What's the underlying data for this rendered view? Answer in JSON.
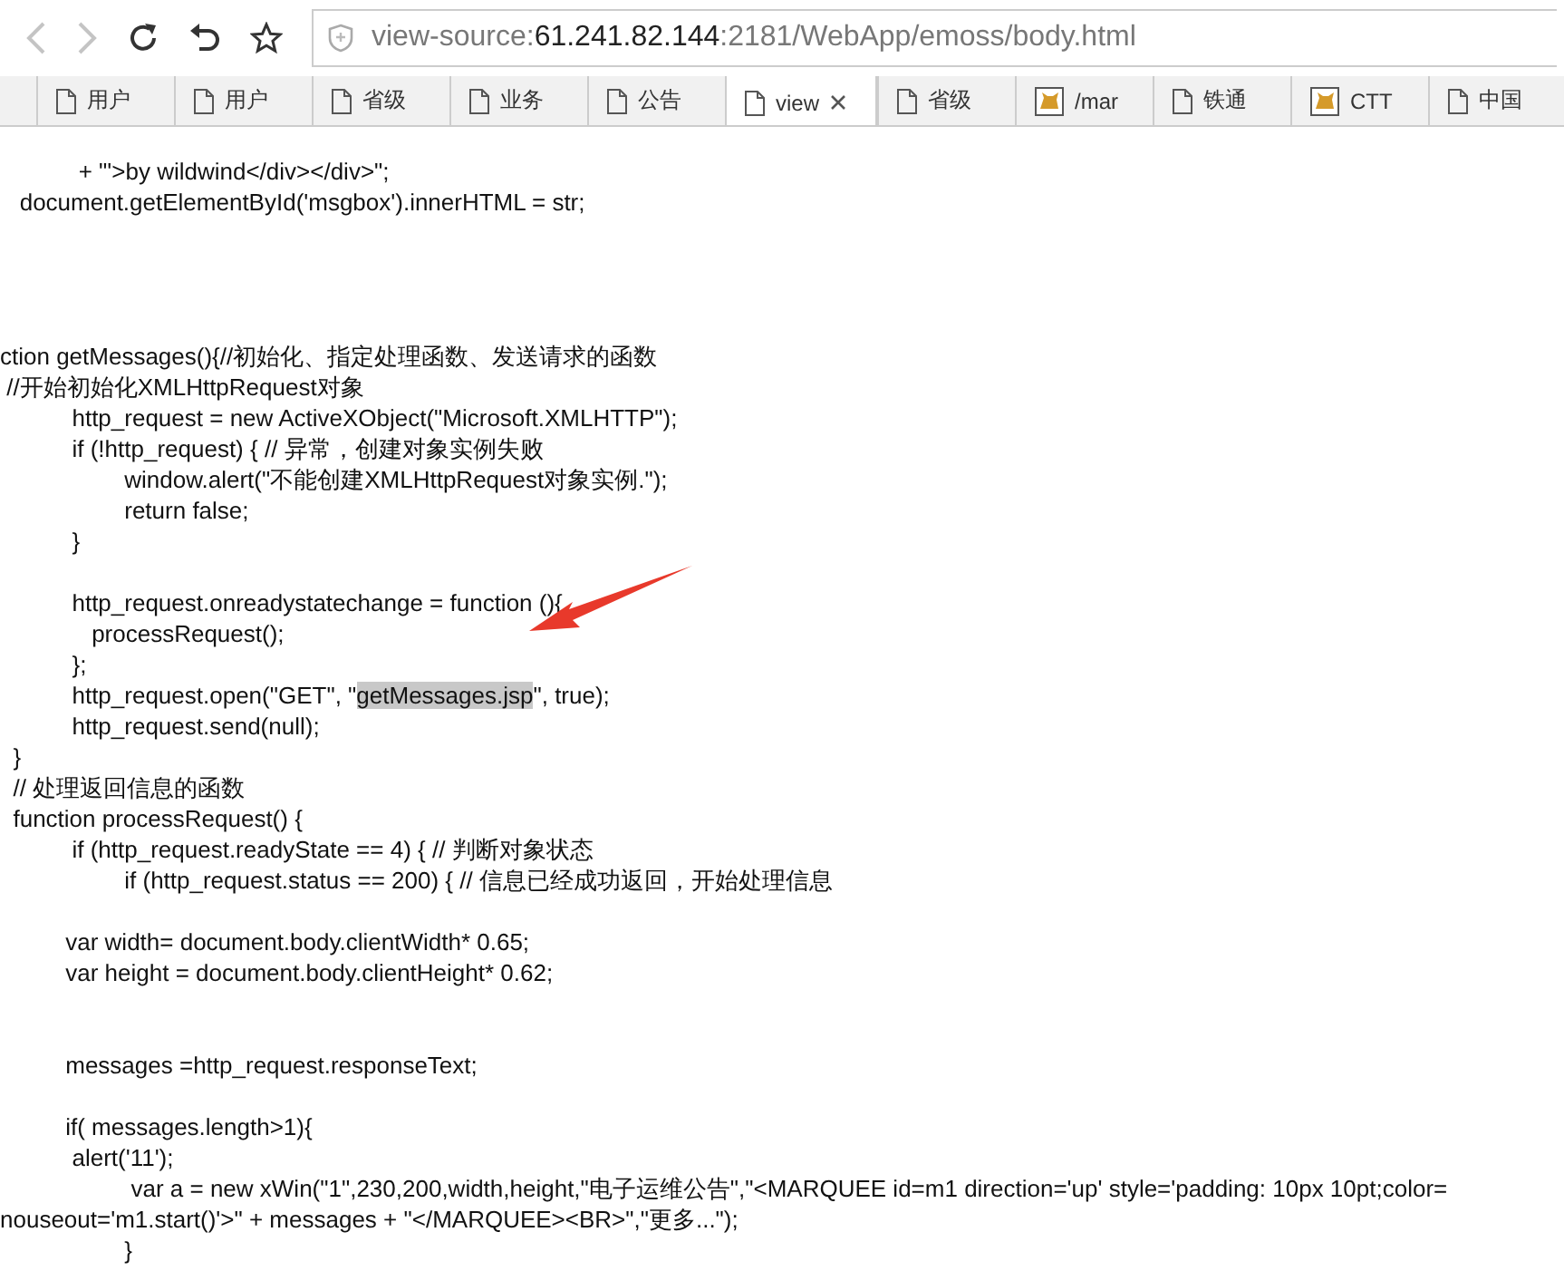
{
  "toolbar": {
    "back_disabled": true,
    "forward_disabled": true,
    "address": {
      "scheme": "view-source:",
      "host": "61.241.82.144",
      "rest": ":2181/WebApp/emoss/body.html"
    }
  },
  "tabs": [
    {
      "label": "用户",
      "kind": "page",
      "selected": false
    },
    {
      "label": "用户",
      "kind": "page",
      "selected": false
    },
    {
      "label": "省级",
      "kind": "page",
      "selected": false
    },
    {
      "label": "业务",
      "kind": "page",
      "selected": false
    },
    {
      "label": "公告",
      "kind": "page",
      "selected": false
    },
    {
      "label": "view",
      "kind": "page",
      "selected": true
    },
    {
      "label": "省级",
      "kind": "page",
      "selected": false
    },
    {
      "label": "/mar",
      "kind": "cat",
      "selected": false
    },
    {
      "label": "铁通",
      "kind": "page",
      "selected": false
    },
    {
      "label": "CTT",
      "kind": "cat",
      "selected": false
    },
    {
      "label": "中国",
      "kind": "page",
      "selected": false
    }
  ],
  "source_lines": [
    {
      "kind": "code",
      "segments": [
        {
          "text": "            + \"'>by wildwind</div></div>\";",
          "selected": false
        }
      ]
    },
    {
      "kind": "code",
      "segments": [
        {
          "text": "   document.getElementById('msgbox').innerHTML = str;",
          "selected": false
        }
      ]
    },
    {
      "kind": "blank"
    },
    {
      "kind": "blank"
    },
    {
      "kind": "blank"
    },
    {
      "kind": "blank"
    },
    {
      "kind": "code",
      "segments": [
        {
          "text": "ction getMessages(){//初始化、指定处理函数、发送请求的函数",
          "selected": false
        }
      ]
    },
    {
      "kind": "code",
      "segments": [
        {
          "text": " //开始初始化XMLHttpRequest对象",
          "selected": false
        }
      ]
    },
    {
      "kind": "code",
      "segments": [
        {
          "text": "           http_request = new ActiveXObject(\"Microsoft.XMLHTTP\");",
          "selected": false
        }
      ]
    },
    {
      "kind": "code",
      "segments": [
        {
          "text": "           if (!http_request) { // 异常，创建对象实例失败",
          "selected": false
        }
      ]
    },
    {
      "kind": "code",
      "segments": [
        {
          "text": "                   window.alert(\"不能创建XMLHttpRequest对象实例.\");",
          "selected": false
        }
      ]
    },
    {
      "kind": "code",
      "segments": [
        {
          "text": "                   return false;",
          "selected": false
        }
      ]
    },
    {
      "kind": "code",
      "segments": [
        {
          "text": "           }",
          "selected": false
        }
      ]
    },
    {
      "kind": "blank"
    },
    {
      "kind": "code",
      "segments": [
        {
          "text": "           http_request.onreadystatechange = function (){",
          "selected": false
        }
      ]
    },
    {
      "kind": "code",
      "segments": [
        {
          "text": "              processRequest();",
          "selected": false
        }
      ]
    },
    {
      "kind": "code",
      "segments": [
        {
          "text": "           };",
          "selected": false
        }
      ]
    },
    {
      "kind": "code",
      "segments": [
        {
          "text": "           http_request.open(\"GET\", \"",
          "selected": false
        },
        {
          "text": "getMessages.jsp",
          "selected": true
        },
        {
          "text": "\", true);",
          "selected": false
        }
      ]
    },
    {
      "kind": "code",
      "segments": [
        {
          "text": "           http_request.send(null);",
          "selected": false
        }
      ]
    },
    {
      "kind": "code",
      "segments": [
        {
          "text": "  }",
          "selected": false
        }
      ]
    },
    {
      "kind": "code",
      "segments": [
        {
          "text": "  // 处理返回信息的函数",
          "selected": false
        }
      ]
    },
    {
      "kind": "code",
      "segments": [
        {
          "text": "  function processRequest() {",
          "selected": false
        }
      ]
    },
    {
      "kind": "code",
      "segments": [
        {
          "text": "           if (http_request.readyState == 4) { // 判断对象状态",
          "selected": false
        }
      ]
    },
    {
      "kind": "code",
      "segments": [
        {
          "text": "                   if (http_request.status == 200) { // 信息已经成功返回，开始处理信息",
          "selected": false
        }
      ]
    },
    {
      "kind": "blank"
    },
    {
      "kind": "code",
      "segments": [
        {
          "text": "          var width= document.body.clientWidth* 0.65;",
          "selected": false
        }
      ]
    },
    {
      "kind": "code",
      "segments": [
        {
          "text": "          var height = document.body.clientHeight* 0.62;",
          "selected": false
        }
      ]
    },
    {
      "kind": "blank"
    },
    {
      "kind": "blank"
    },
    {
      "kind": "code",
      "segments": [
        {
          "text": "          messages =http_request.responseText;",
          "selected": false
        }
      ]
    },
    {
      "kind": "blank"
    },
    {
      "kind": "code",
      "segments": [
        {
          "text": "          if( messages.length>1){",
          "selected": false
        }
      ]
    },
    {
      "kind": "code",
      "segments": [
        {
          "text": "           alert('11');",
          "selected": false
        }
      ]
    },
    {
      "kind": "code",
      "segments": [
        {
          "text": "                    var a = new xWin(\"1\",230,200,width,height,\"电子运维公告\",\"<MARQUEE id=m1 direction='up' style='padding: 10px 10pt;color=",
          "selected": false
        }
      ]
    },
    {
      "kind": "code",
      "segments": [
        {
          "text": "nouseout='m1.start()'>\" + messages + \"</MARQUEE><BR>\",\"更多...\");",
          "selected": false
        }
      ]
    },
    {
      "kind": "code",
      "segments": [
        {
          "text": "                   }",
          "selected": false
        }
      ]
    }
  ]
}
